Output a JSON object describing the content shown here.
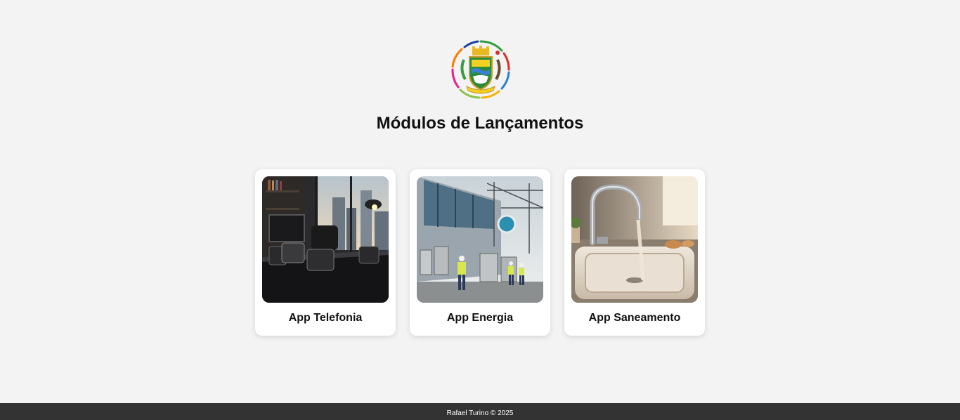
{
  "header": {
    "title": "Módulos de Lançamentos",
    "logo_icon": "city-coat-of-arms-logo"
  },
  "cards": [
    {
      "label": "App Telefonia",
      "image": "office-telephones-image"
    },
    {
      "label": "App Energia",
      "image": "energy-substation-workers-image"
    },
    {
      "label": "App Saneamento",
      "image": "kitchen-faucet-sink-image"
    }
  ],
  "footer": {
    "text": "Rafael Turino © 2025"
  },
  "colors": {
    "background": "#f3f3f3",
    "card_background": "#ffffff",
    "footer_background": "#333333",
    "footer_text": "#ffffff"
  }
}
